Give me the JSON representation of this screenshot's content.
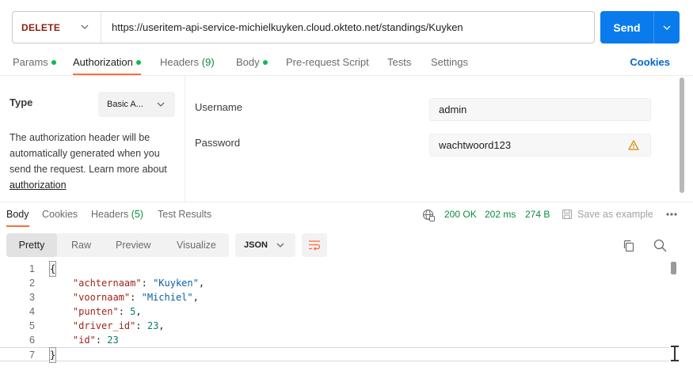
{
  "request": {
    "method": "DELETE",
    "url": "https://useritem-api-service-michielkuyken.cloud.okteto.net/standings/Kuyken",
    "send_label": "Send"
  },
  "request_tabs": {
    "params": "Params",
    "authorization": "Authorization",
    "headers": "Headers",
    "headers_count": "(9)",
    "body": "Body",
    "pre_request": "Pre-request Script",
    "tests": "Tests",
    "settings": "Settings",
    "cookies": "Cookies"
  },
  "auth": {
    "type_label": "Type",
    "type_value": "Basic A...",
    "description": "The authorization header will be automatically generated when you send the request. Learn more about",
    "link_text": "authorization",
    "username_label": "Username",
    "username_value": "admin",
    "password_label": "Password",
    "password_value": "wachtwoord123"
  },
  "response_tabs": {
    "body": "Body",
    "cookies": "Cookies",
    "headers": "Headers",
    "headers_count": "(5)",
    "test_results": "Test Results"
  },
  "response_status": {
    "status": "200 OK",
    "time": "202 ms",
    "size": "274 B",
    "save_example": "Save as example"
  },
  "view": {
    "modes": [
      "Pretty",
      "Raw",
      "Preview",
      "Visualize"
    ],
    "active_mode": "Pretty",
    "format": "JSON"
  },
  "colors": {
    "accent": "#ff6c37",
    "send": "#097bed",
    "method": "#8a1f11",
    "status_ok": "#0b8a3f",
    "link": "#0265d2"
  },
  "code": {
    "line_numbers": [
      "1",
      "2",
      "3",
      "4",
      "5",
      "6",
      "7"
    ],
    "open_brace": "{",
    "close_brace": "}",
    "fields": [
      {
        "key": "\"achternaam\"",
        "value": "\"Kuyken\"",
        "type": "string",
        "sep": ","
      },
      {
        "key": "\"voornaam\"",
        "value": "\"Michiel\"",
        "type": "string",
        "sep": ","
      },
      {
        "key": "\"punten\"",
        "value": "5",
        "type": "number",
        "sep": ","
      },
      {
        "key": "\"driver_id\"",
        "value": "23",
        "type": "number",
        "sep": ","
      },
      {
        "key": "\"id\"",
        "value": "23",
        "type": "number",
        "sep": ""
      }
    ]
  }
}
